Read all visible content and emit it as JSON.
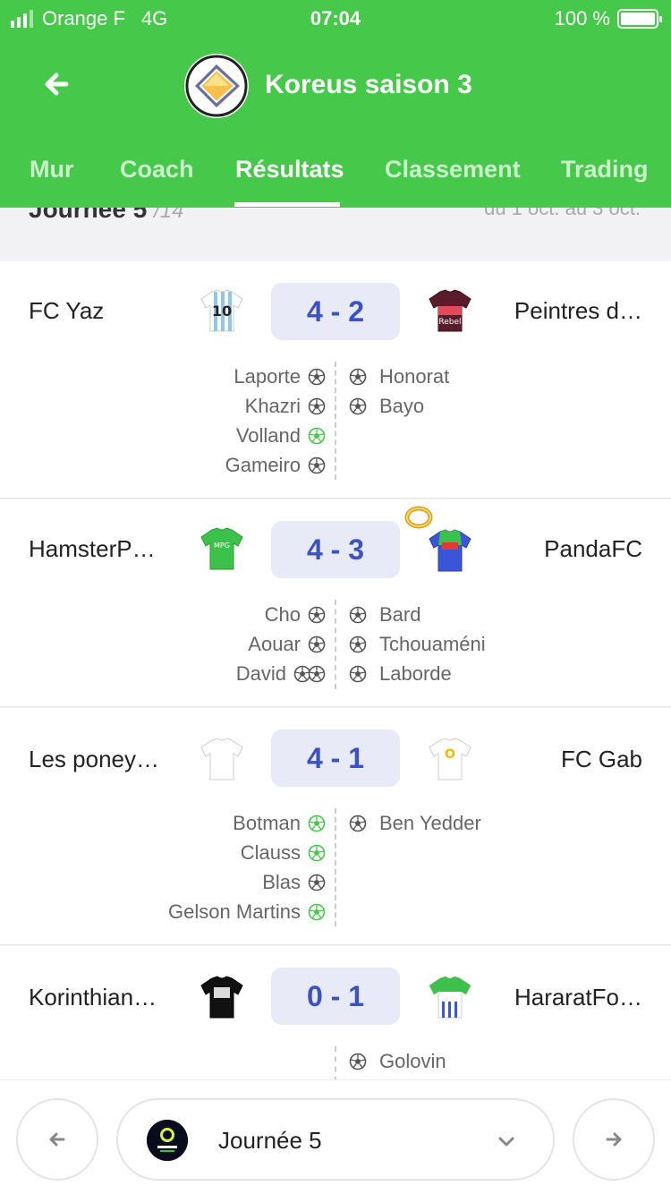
{
  "status_bar": {
    "carrier": "Orange F",
    "network": "4G",
    "time": "07:04",
    "battery": "100 %"
  },
  "header": {
    "title": "Koreus saison 3",
    "tabs": [
      {
        "label": "Mur"
      },
      {
        "label": "Coach"
      },
      {
        "label": "Résultats",
        "active": true
      },
      {
        "label": "Classement"
      },
      {
        "label": "Trading"
      }
    ]
  },
  "day_header": {
    "day": "Journée 5",
    "total": "/14",
    "range": "du 1 oct. au 3 oct."
  },
  "colors": {
    "brand_green": "#46c84a",
    "score_text": "#3b52c4",
    "score_bg": "#e8ebf7",
    "ball_green": "#46c84a"
  },
  "matches": [
    {
      "home": "FC Yaz",
      "away": "Peintres d…",
      "score": "4 - 2",
      "home_jersey": "blue-white-stripes-10-jersey-icon",
      "away_jersey": "bordeaux-rebel-jersey-icon",
      "home_scorers": [
        {
          "name": "Laporte",
          "goals": 1,
          "green": false
        },
        {
          "name": "Khazri",
          "goals": 1,
          "green": false
        },
        {
          "name": "Volland",
          "goals": 1,
          "green": true
        },
        {
          "name": "Gameiro",
          "goals": 1,
          "green": false
        }
      ],
      "away_scorers": [
        {
          "name": "Honorat",
          "goals": 1,
          "green": false
        },
        {
          "name": "Bayo",
          "goals": 1,
          "green": false
        }
      ]
    },
    {
      "home": "HamsterP…",
      "away": "PandaFC",
      "score": "4 - 3",
      "home_jersey": "green-mpg-jersey-icon",
      "away_jersey": "blue-red-redbull-jersey-icon",
      "away_bonus": "gold-ring-icon",
      "home_scorers": [
        {
          "name": "Cho",
          "goals": 1,
          "green": false
        },
        {
          "name": "Aouar",
          "goals": 1,
          "green": false
        },
        {
          "name": "David",
          "goals": 2,
          "green": false
        }
      ],
      "away_scorers": [
        {
          "name": "Bard",
          "goals": 1,
          "green": false
        },
        {
          "name": "Tchouaméni",
          "goals": 1,
          "green": false
        },
        {
          "name": "Laborde",
          "goals": 1,
          "green": false
        }
      ]
    },
    {
      "home": "Les poney…",
      "away": "FC Gab",
      "score": "4 - 1",
      "home_jersey": "white-jersey-icon",
      "away_jersey": "white-orange-logo-jersey-icon",
      "home_scorers": [
        {
          "name": "Botman",
          "goals": 1,
          "green": true
        },
        {
          "name": "Clauss",
          "goals": 1,
          "green": true
        },
        {
          "name": "Blas",
          "goals": 1,
          "green": false
        },
        {
          "name": "Gelson Martins",
          "goals": 1,
          "green": true
        }
      ],
      "away_scorers": [
        {
          "name": "Ben Yedder",
          "goals": 1,
          "green": false
        }
      ]
    },
    {
      "home": "Korinthian…",
      "away": "HararatFo…",
      "score": "0 - 1",
      "home_jersey": "black-jersey-icon",
      "away_jersey": "white-blue-green-mpg-jersey-icon",
      "home_scorers": [],
      "away_scorers": [
        {
          "name": "Golovin",
          "goals": 1,
          "green": false
        }
      ]
    }
  ],
  "bottom_bar": {
    "day_label": "Journée 5",
    "prev_icon": "arrow-left-icon",
    "next_icon": "arrow-right-icon"
  }
}
